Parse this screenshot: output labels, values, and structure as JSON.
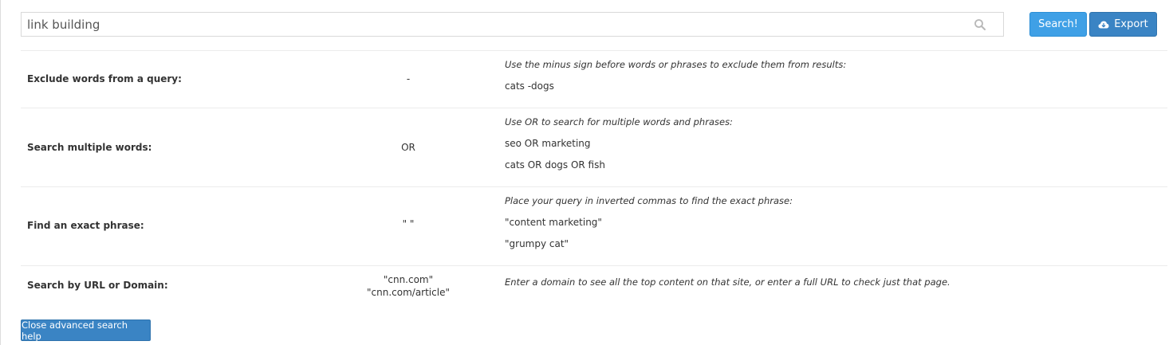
{
  "search": {
    "value": "link building",
    "search_button": "Search!",
    "export_button": "Export"
  },
  "help_rows": [
    {
      "label": "Exclude words from a query:",
      "operator": "-",
      "description": "Use the minus sign before words or phrases to exclude them from results:",
      "examples": [
        "cats -dogs"
      ]
    },
    {
      "label": "Search multiple words:",
      "operator": "OR",
      "description": "Use OR to search for multiple words and phrases:",
      "examples": [
        "seo OR marketing",
        "cats OR dogs OR fish"
      ]
    },
    {
      "label": "Find an exact phrase:",
      "operator": "\" \"",
      "description": "Place your query in inverted commas to find the exact phrase:",
      "examples": [
        "\"content marketing\"",
        "\"grumpy cat\""
      ]
    },
    {
      "label": "Search by URL or Domain:",
      "operator": "\"cnn.com\"",
      "operator_2": "\"cnn.com/article\"",
      "description": "Enter a domain to see all the top content on that site, or enter a full URL to check just that page.",
      "examples": []
    }
  ],
  "close_button": "Close advanced search help",
  "colors": {
    "search_button": "#3fa0e6",
    "export_button": "#3a84c4",
    "close_button": "#3a84c4"
  }
}
